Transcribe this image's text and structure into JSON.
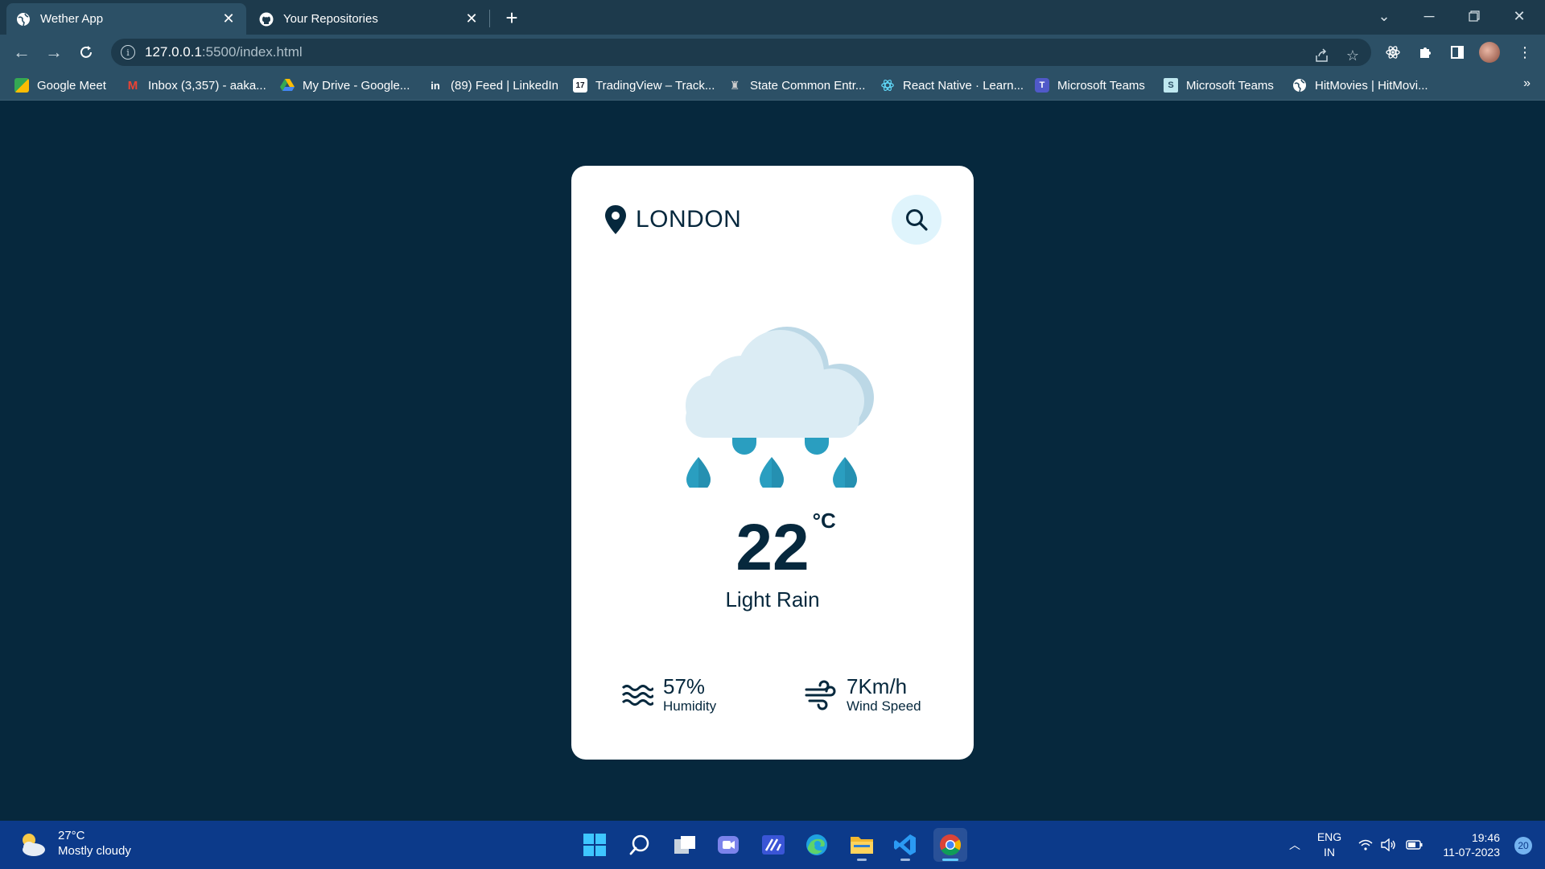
{
  "browser": {
    "tabs": [
      {
        "title": "Wether App",
        "active": true,
        "icon": "globe-icon"
      },
      {
        "title": "Your Repositories",
        "active": false,
        "icon": "github-icon"
      }
    ],
    "new_tab_symbol": "+",
    "url_host": "127.0.0.1",
    "url_path": ":5500/index.html",
    "bookmarks": [
      {
        "label": "Google Meet",
        "icon": "meet-icon"
      },
      {
        "label": "Inbox (3,357) - aaka...",
        "icon": "gmail-icon"
      },
      {
        "label": "My Drive - Google...",
        "icon": "drive-icon"
      },
      {
        "label": "(89) Feed | LinkedIn",
        "icon": "linkedin-icon"
      },
      {
        "label": "TradingView – Track...",
        "icon": "tradingview-icon"
      },
      {
        "label": "State Common Entr...",
        "icon": "emblem-icon"
      },
      {
        "label": "React Native · Learn...",
        "icon": "react-icon"
      },
      {
        "label": "Microsoft Teams",
        "icon": "teams-icon"
      },
      {
        "label": "Microsoft Teams",
        "icon": "teams-s-icon"
      },
      {
        "label": "HitMovies | HitMovi...",
        "icon": "globe-icon"
      }
    ],
    "bookmarks_more": "»"
  },
  "weather": {
    "city": "LONDON",
    "temperature": "22",
    "unit": "°C",
    "description": "Light Rain",
    "humidity_value": "57%",
    "humidity_label": "Humidity",
    "wind_value": "7Km/h",
    "wind_label": "Wind Speed"
  },
  "taskbar": {
    "weather_temp": "27°C",
    "weather_condition": "Mostly cloudy",
    "language": "ENG",
    "region": "IN",
    "time": "19:46",
    "date": "11-07-2023",
    "notification_count": "20"
  },
  "colors": {
    "page_background": "#06283d",
    "card_background": "#ffffff",
    "text_primary": "#06283d",
    "search_background": "#dff4fc",
    "cloud": "#dbecf4",
    "raindrop": "#2a9ec0"
  }
}
